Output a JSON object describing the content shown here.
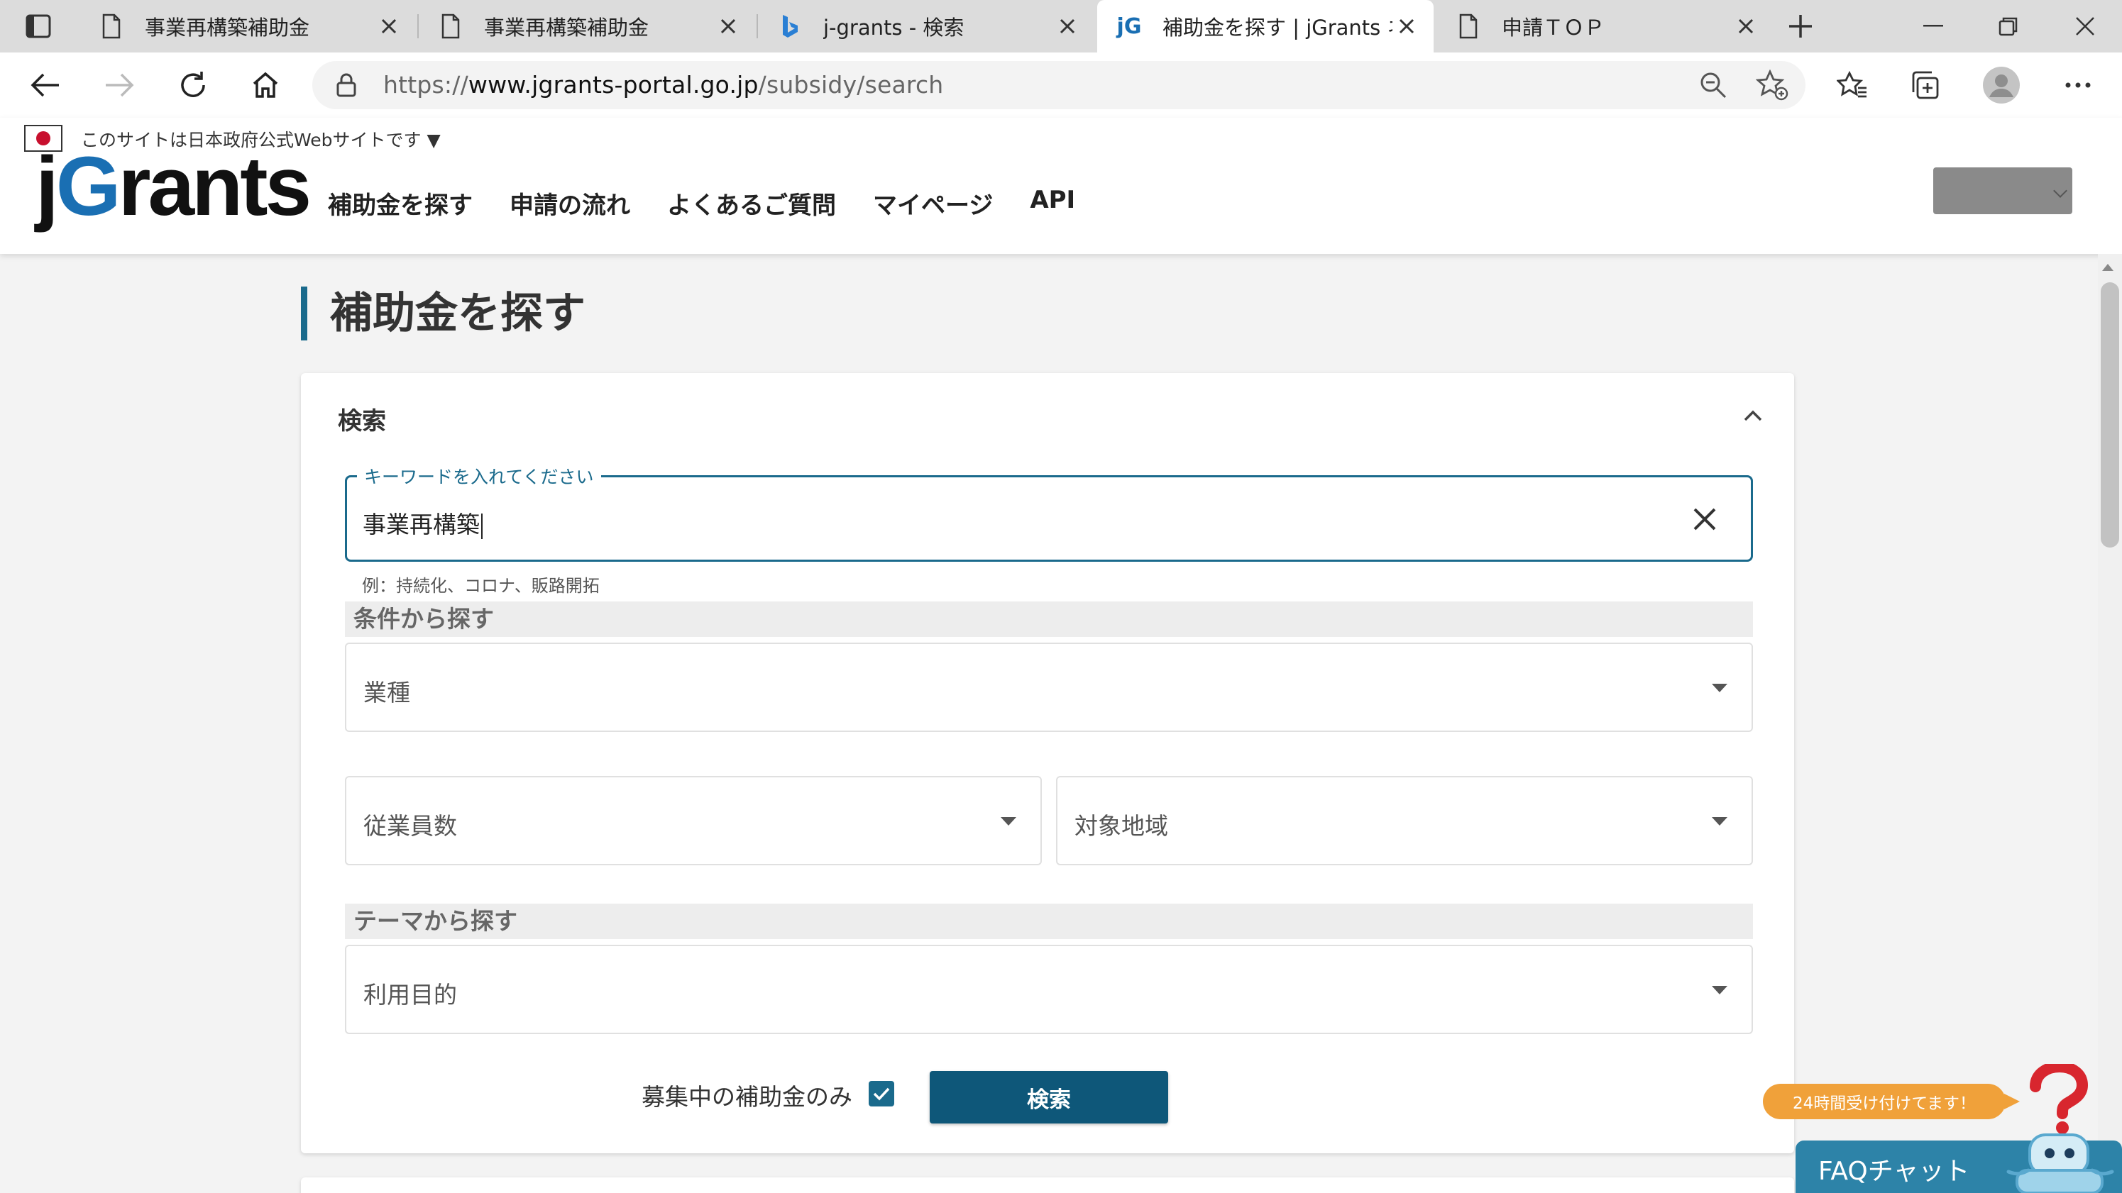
{
  "browser": {
    "tabs": [
      {
        "label": "事業再構築補助金",
        "icon": "page-icon"
      },
      {
        "label": "事業再構築補助金",
        "icon": "page-icon"
      },
      {
        "label": "j-grants - 検索",
        "icon": "bing-icon"
      },
      {
        "label": "補助金を探す | jGrants ネット",
        "icon": "jgrants-favicon",
        "favicon_text": "jG",
        "active": true
      },
      {
        "label": "申請ＴＯＰ",
        "icon": "page-icon"
      }
    ],
    "url_prefix": "https://",
    "url_domain": "www.jgrants-portal.go.jp",
    "url_path": "/subsidy/search"
  },
  "site": {
    "gov_notice": "このサイトは日本政府公式Webサイトです ▼",
    "logo": {
      "j": "j",
      "g": "G",
      "rest": "rants"
    },
    "nav": [
      "補助金を探す",
      "申請の流れ",
      "よくあるご質問",
      "マイページ",
      "API"
    ]
  },
  "page": {
    "title": "補助金を探す",
    "search": {
      "section_title": "検索",
      "keyword_label": "キーワードを入れてください",
      "keyword_value": "事業再構築",
      "keyword_hint": "例：持続化、コロナ、販路開拓",
      "conditions_heading": "条件から探す",
      "industry_placeholder": "業種",
      "employees_placeholder": "従業員数",
      "region_placeholder": "対象地域",
      "theme_heading": "テーマから探す",
      "purpose_placeholder": "利用目的",
      "recruiting_only_label": "募集中の補助金のみ",
      "recruiting_only_checked": true,
      "search_button": "検索"
    }
  },
  "faq": {
    "bubble": "24時間受け付けてます！",
    "label": "FAQチャット"
  },
  "colors": {
    "accent": "#1a6a8c",
    "button": "#0e5779",
    "faq_bar": "#2d83a8",
    "faq_bubble": "#f0a13a"
  }
}
